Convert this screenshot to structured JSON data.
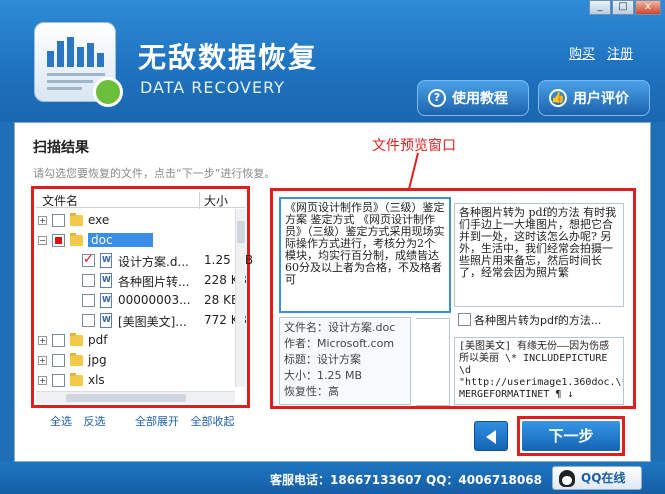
{
  "app": {
    "title_cn": "无敌数据恢复",
    "title_en": "DATA RECOVERY",
    "links": {
      "buy": "购买",
      "register": "注册"
    },
    "buttons": {
      "tutorial": "使用教程",
      "review": "用户评价"
    },
    "window": {
      "minimize": "_",
      "maximize": "□",
      "close": "x"
    }
  },
  "main": {
    "scan_title": "扫描结果",
    "hint": "请勾选您要恢复的文件，点击“下一步”进行恢复。",
    "preview_label": "文件预览窗口"
  },
  "tree": {
    "col_name": "文件名",
    "col_size": "大小",
    "rows": [
      {
        "name": "exe",
        "size": "",
        "expander": "+",
        "check": "off",
        "type": "folder",
        "level": 0
      },
      {
        "name": "doc",
        "size": "",
        "expander": "−",
        "check": "part",
        "type": "folder",
        "level": 0,
        "selected": true
      },
      {
        "name": "设计方案.d...",
        "size": "1.25 MB",
        "expander": "",
        "check": "on",
        "type": "file",
        "level": 1
      },
      {
        "name": "各种图片转...",
        "size": "228 KB",
        "expander": "",
        "check": "off",
        "type": "file",
        "level": 1
      },
      {
        "name": "00000003...",
        "size": "28 KB",
        "expander": "",
        "check": "off",
        "type": "file",
        "level": 1
      },
      {
        "name": "[美图美文]...",
        "size": "772 KB",
        "expander": "",
        "check": "off",
        "type": "file",
        "level": 1
      },
      {
        "name": "pdf",
        "size": "",
        "expander": "+",
        "check": "off",
        "type": "folder",
        "level": 0
      },
      {
        "name": "jpg",
        "size": "",
        "expander": "+",
        "check": "off",
        "type": "folder",
        "level": 0
      },
      {
        "name": "xls",
        "size": "",
        "expander": "+",
        "check": "off",
        "type": "folder",
        "level": 0
      }
    ],
    "actions": {
      "select_all": "全选",
      "invert": "反选",
      "expand_all": "全部展开",
      "collapse_all": "全部收起"
    }
  },
  "preview": {
    "doc1_text": "《网页设计制作员》（三级）鉴定方案 鉴定方式 《网页设计制作员》（三级）鉴定方式采用现场实际操作方式进行，考核分为2个模块，均实行百分制，成绩皆达60分及以上者为合格，不及格者可",
    "doc2_text": "各种图片转为 pdf的方法 有时我们手边上一大堆图片，想把它合并到一处，这时该怎么办呢? 另外，生活中，我们经常会拍摄一些照片用来备忘，然后时间长了，经常会因为照片繁",
    "doc3_text": "[美图美文] 有缘无份——因为伤感所以美丽 \\* INCLUDEPICTURE \\d \"http://userimage1.360doc.\\* MERGEFORMATINET ¶ ↓",
    "info": {
      "filename": "文件名：设计方案.doc",
      "author": "作者：Microsoft.com",
      "subject": "标题：设计方案",
      "size": "大小：1.25 MB",
      "recovery": "恢复性：高"
    },
    "doc2_caption": "各种图片转为pdf的方法..."
  },
  "nav": {
    "next": "下一步"
  },
  "footer": {
    "hotline": "客服电话：18667133607 QQ：4006718068",
    "qq_online": "QQ在线"
  }
}
